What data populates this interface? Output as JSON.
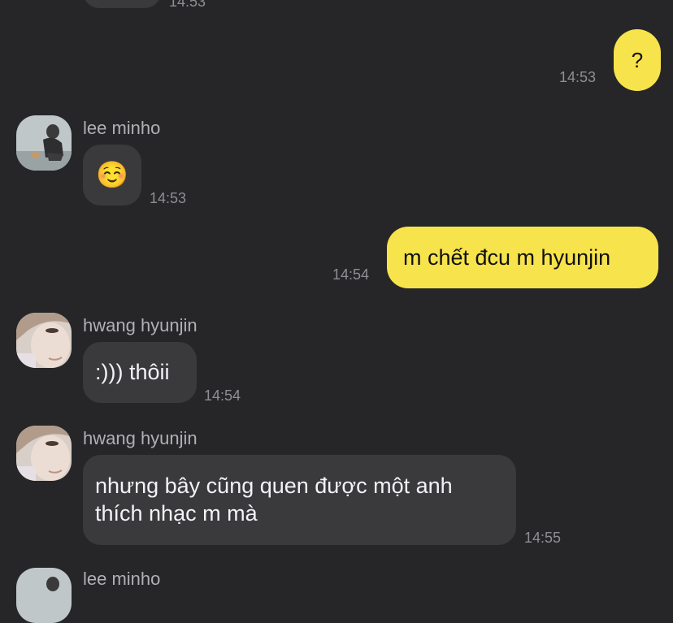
{
  "colors": {
    "background": "#262628",
    "incoming_bubble": "#3a3a3c",
    "outgoing_bubble": "#f7e34b",
    "timestamp": "#8e8e93",
    "sender_name": "#b0b0b5"
  },
  "messages": [
    {
      "time": "14:53"
    },
    {
      "text": "?",
      "time": "14:53"
    },
    {
      "sender": "lee minho",
      "text": "☺️",
      "time": "14:53"
    },
    {
      "text": "m chết đcu m hyunjin",
      "time": "14:54"
    },
    {
      "sender": "hwang hyunjin",
      "text": ":))) thôii",
      "time": "14:54"
    },
    {
      "sender": "hwang hyunjin",
      "text": "nhưng bây cũng quen được một anh thích nhạc m mà",
      "time": "14:55"
    },
    {
      "sender": "lee minho"
    }
  ]
}
